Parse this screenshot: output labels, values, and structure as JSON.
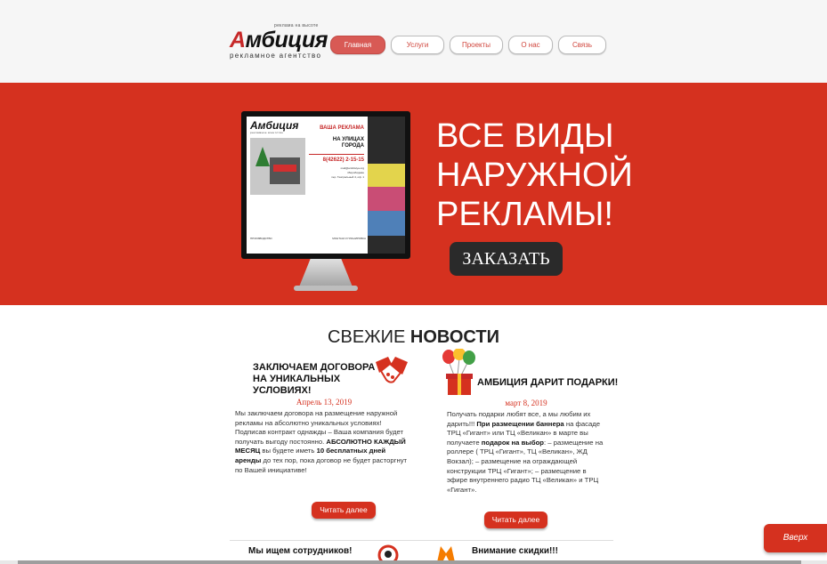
{
  "header": {
    "logo": {
      "tagline": "реклама на высоте",
      "name_cap": "А",
      "name_rest": "мбиция",
      "subtitle": "рекламное агентство"
    },
    "nav": [
      {
        "label": "Главная",
        "active": true
      },
      {
        "label": "Услуги",
        "active": false
      },
      {
        "label": "Проекты",
        "active": false
      },
      {
        "label": "О нас",
        "active": false
      },
      {
        "label": "Связь",
        "active": false
      }
    ]
  },
  "hero": {
    "billboard": {
      "logo": "Амбиция",
      "logo_sub": "рекламное агентство",
      "headline1": "ВАША РЕКЛАМА",
      "headline2a": "НА УЛИЦАХ",
      "headline2b": "ГОРОДА",
      "phone": "8(42622) 2-15-15",
      "contact1": "mail@ambitsiya.org",
      "contact2": "г.Биробиджан",
      "contact3": "пер. Театральный 4, оф. 1",
      "footer_left": "ПРОИЗВОДСТВО",
      "footer_right": "МОНТАЖ И ПЛАНИРОВКА"
    },
    "title": [
      "ВСЕ ВИДЫ",
      "НАРУЖНОЙ",
      "РЕКЛАМЫ!"
    ],
    "order_button": "ЗАКАЗАТЬ"
  },
  "news": {
    "title_light": "СВЕЖИЕ ",
    "title_bold": "НОВОСТИ",
    "items": [
      {
        "headline1": "ЗАКЛЮЧАЕМ ДОГОВОРА",
        "headline2": "НА УНИКАЛЬНЫХ УСЛОВИЯХ!",
        "date": "Апрель 13, 2019",
        "text1": "Мы заключаем договора на размещение наружной рекламы на абсолютно уникальных условиях! Подписав контракт однажды – Ваша компания будет получать выгоду постоянно. ",
        "bold1": "АБСОЛЮТНО КАЖДЫЙ МЕСЯЦ",
        "text2": " вы будете иметь ",
        "bold2": "10 бесплатных дней аренды",
        "text3": " до тех пор, пока договор не будет расторгнут по Вашей инициативе!",
        "icon": "handshake-icon",
        "button": "Читать далее"
      },
      {
        "headline1": "АМБИЦИЯ ДАРИТ ПОДАРКИ!",
        "date": "март 8, 2019",
        "text1": "Получать подарки любят все, а мы любим их дарить!!! ",
        "bold1": "При размещении баннера",
        "text2": " на фасаде ТРЦ «Гигант» или ТЦ «Великан» в марте вы получаете ",
        "bold2": "подарок на выбор",
        "text3": ": – размещение на роллере ( ТРЦ «Гигант», ТЦ «Великан», ЖД Вокзал); – размещение на ограждающей конструкции ТРЦ «Гигант»; – размещение в эфире внутреннего радио ТЦ «Великан» и ТРЦ «Гигант».",
        "icon": "gift-icon",
        "button": "Читать далее"
      }
    ],
    "next_items": [
      {
        "title": "Мы ищем сотрудников!",
        "icon": "person-icon"
      },
      {
        "title": "Внимание скидки!!!",
        "icon": "fox-icon"
      }
    ]
  },
  "to_top_button": "Вверх",
  "colors": {
    "brand_red": "#d5311f",
    "nav_active": "#d85a55",
    "dark_button": "#2a2a2a"
  }
}
